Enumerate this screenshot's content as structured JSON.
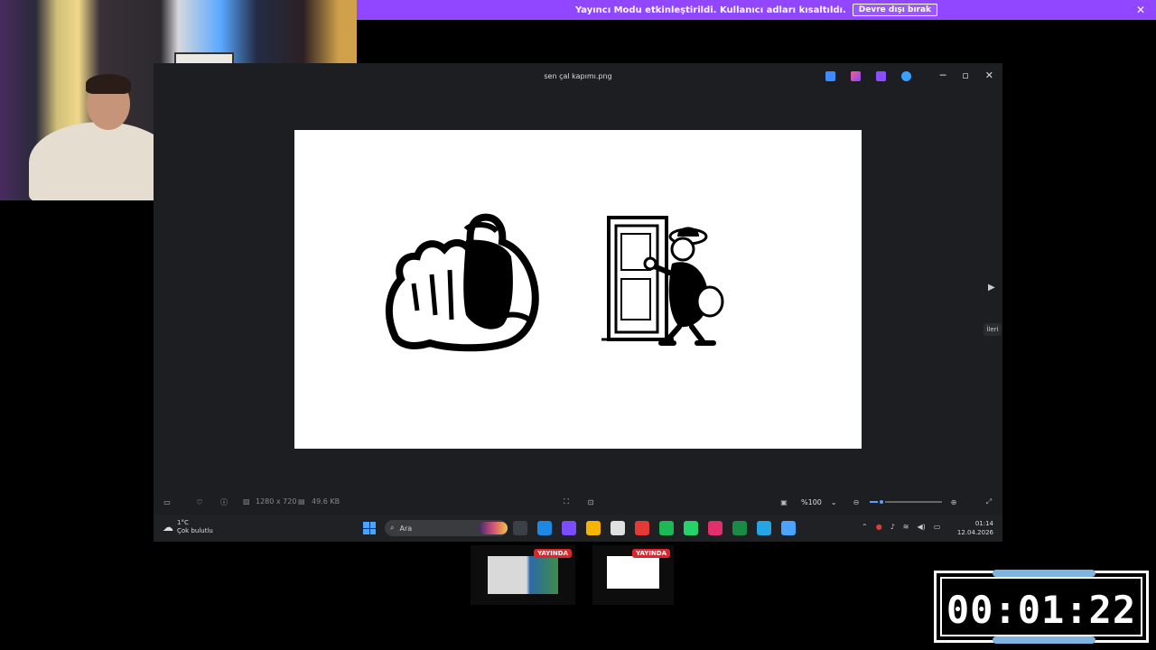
{
  "banner": {
    "message": "Yayıncı Modu etkinleştirildi. Kullanıcı adları kısaltıldı.",
    "dismiss_label": "Devre dışı bırak",
    "close_icon": "✕"
  },
  "photos_window": {
    "title": "sen çal kapımı.png",
    "next_tooltip": "İleri",
    "image_info": {
      "dimensions": "1280 x 720",
      "file_size": "49.6 KB"
    },
    "zoom_level": "%100",
    "zoom_slider_fraction": 0.16
  },
  "taskbar": {
    "weather_temp": "1°C",
    "weather_desc": "Çok bulutlu",
    "search_placeholder": "Ara",
    "time": "01:14",
    "date": "12.04.2026",
    "apps": [
      {
        "name": "file-explorer-icon",
        "color": "#3b3f46"
      },
      {
        "name": "edge-icon",
        "color": "#1e88e5"
      },
      {
        "name": "copilot-icon",
        "color": "#7c4dff"
      },
      {
        "name": "folder-icon",
        "color": "#f5b400"
      },
      {
        "name": "store-icon",
        "color": "#e0e0e0"
      },
      {
        "name": "chrome-icon",
        "color": "#e53935"
      },
      {
        "name": "spotify-icon",
        "color": "#1db954"
      },
      {
        "name": "whatsapp-icon",
        "color": "#25d366"
      },
      {
        "name": "instagram-icon",
        "color": "#e1306c"
      },
      {
        "name": "excel-icon",
        "color": "#1b8a45"
      },
      {
        "name": "globe-icon",
        "color": "#26a5e4"
      },
      {
        "name": "photos-icon",
        "color": "#4aa3ff"
      }
    ]
  },
  "thumbnails": [
    {
      "badge": "YAYINDA"
    },
    {
      "badge": "YAYINDA"
    }
  ],
  "timer": {
    "display": "00:01:22"
  }
}
